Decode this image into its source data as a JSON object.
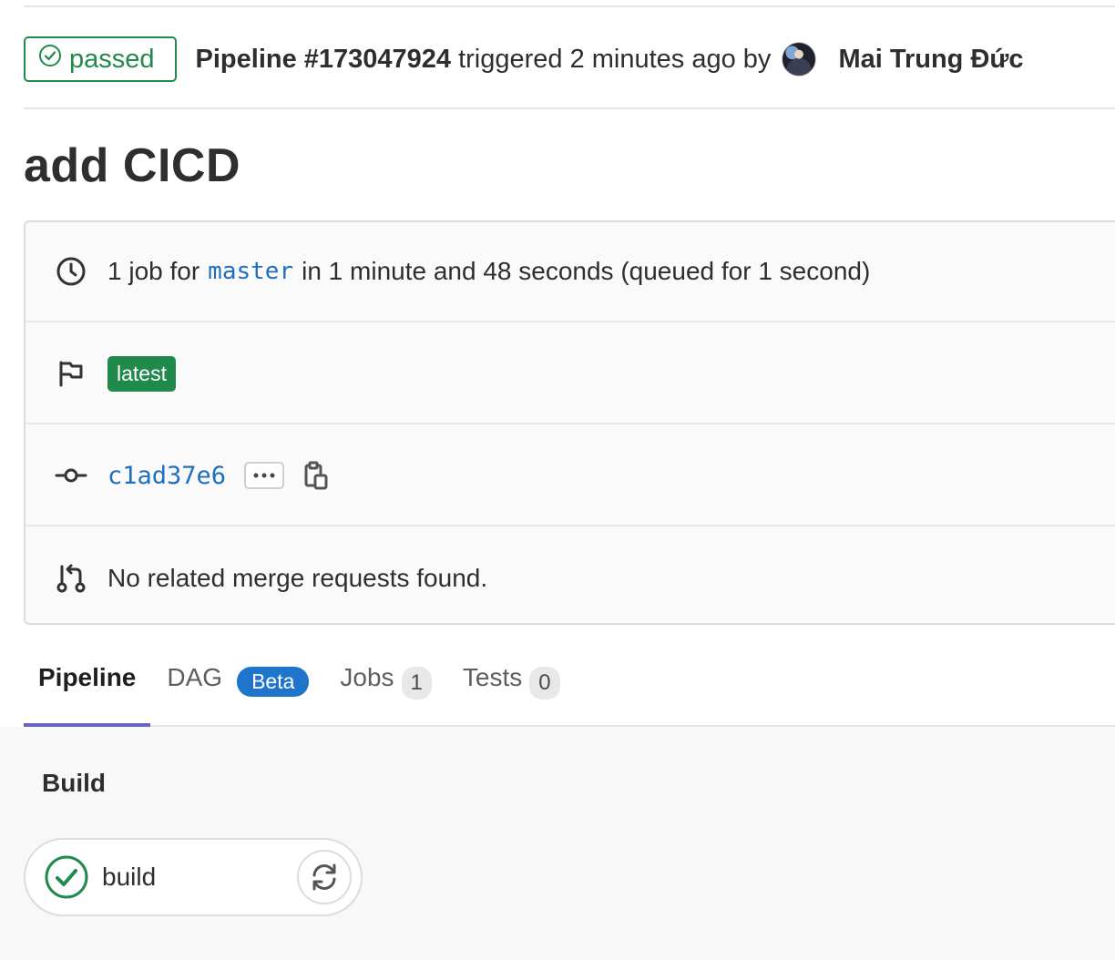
{
  "header": {
    "status": "passed",
    "pipeline_id": "Pipeline #173047924",
    "triggered_text": "triggered 2 minutes ago by",
    "author": "Mai Trung Đức"
  },
  "title": "add CICD",
  "info": {
    "job_count": "1 job for",
    "branch": "master",
    "duration_text": "in 1 minute and 48 seconds (queued for 1 second)",
    "badge": "latest",
    "commit_sha": "c1ad37e6",
    "merge_requests": "No related merge requests found."
  },
  "tabs": [
    {
      "label": "Pipeline",
      "active": true
    },
    {
      "label": "DAG",
      "badge": "Beta"
    },
    {
      "label": "Jobs",
      "count": "1"
    },
    {
      "label": "Tests",
      "count": "0"
    }
  ],
  "stage": {
    "title": "Build",
    "jobs": [
      {
        "name": "build",
        "status": "success"
      }
    ]
  },
  "colors": {
    "success": "#1f8a4c",
    "link": "#1f6fbf",
    "beta": "#1f75cb",
    "active_tab": "#6666c4"
  },
  "icons": [
    "status-success-icon",
    "clock-icon",
    "flag-icon",
    "commit-icon",
    "ellipsis-icon",
    "copy-clipboard-icon",
    "merge-request-icon",
    "retry-icon"
  ]
}
